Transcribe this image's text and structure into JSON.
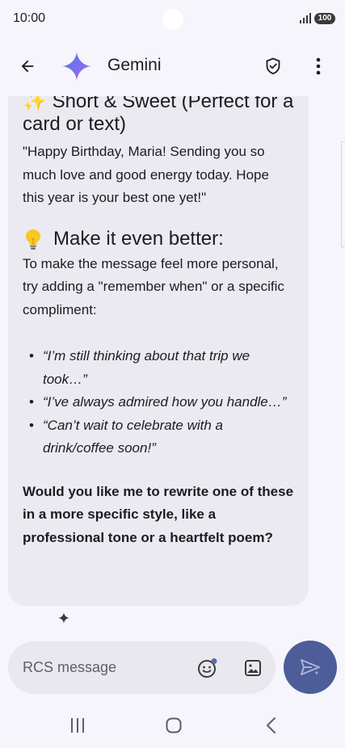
{
  "status_bar": {
    "time": "10:00",
    "battery": "100",
    "icons": [
      "signal-icon",
      "battery-icon"
    ]
  },
  "app_bar": {
    "title": "Gemini",
    "icons": [
      "back-arrow-icon",
      "gemini-logo-icon",
      "shield-check-icon",
      "more-vert-icon"
    ]
  },
  "message": {
    "heading_short_emoji": "✨",
    "heading_short_text": "Short & Sweet (Perfect for a card or text)",
    "short_message": "\"Happy Birthday, Maria! Sending you so much love and good energy today. Hope this year is your best one yet!\"",
    "heading_better_emoji": "💡",
    "heading_better_text": "Make it even better:",
    "better_intro": "To make the message feel more personal, try adding a \"remember when\" or a specific compliment:",
    "examples": [
      "“I’m still thinking about that trip we took…”",
      "“I’ve always admired how you handle…”",
      "“Can’t wait to celebrate with a drink/coffee soon!”"
    ],
    "closing_question": "Would you like me to rewrite one of these in a more specific style, like a professional tone or a heartfelt poem?"
  },
  "composer": {
    "placeholder": "RCS message",
    "value": "",
    "icons": [
      "emoji-icon",
      "image-icon",
      "send-icon"
    ]
  },
  "nav_bar": {
    "icons": [
      "recents-icon",
      "home-icon",
      "nav-back-icon"
    ]
  },
  "colors": {
    "background": "#f6f5fb",
    "bubble": "#ebeaf1",
    "send_button": "#4d5d9a",
    "text": "#1d1b20"
  }
}
